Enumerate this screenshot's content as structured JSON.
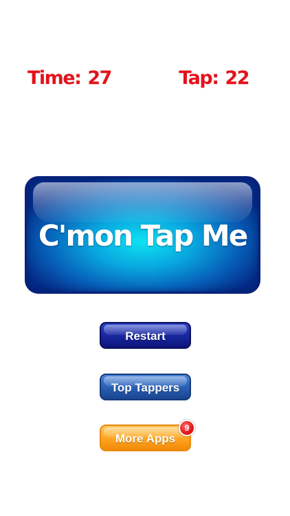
{
  "stats": {
    "time_label": "Time:",
    "time_value": "27",
    "tap_label": "Tap:",
    "tap_value": "22",
    "color": "#e5121b"
  },
  "main_button": {
    "label": "C'mon Tap Me"
  },
  "buttons": {
    "restart": "Restart",
    "top_tappers": "Top Tappers",
    "more_apps": "More Apps",
    "more_apps_badge": "9"
  },
  "colors": {
    "main_button_center": "#0ee3f2",
    "main_button_edge": "#042a86",
    "restart": "#1a2aa3",
    "top_tappers": "#2b62b8",
    "more_apps": "#ffa724",
    "badge": "#e01818"
  }
}
